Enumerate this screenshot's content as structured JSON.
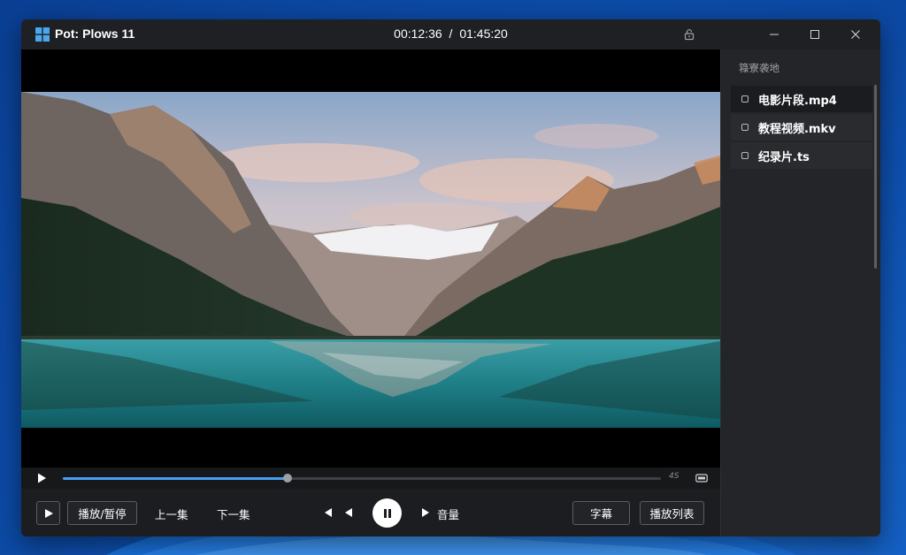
{
  "window": {
    "title": "Pot: Plows 11",
    "current_time": "00:12:36",
    "time_separator": "/",
    "total_time": "01:45:20"
  },
  "icons": {
    "app_logo": "windows-logo-icon",
    "lock": "lock-icon",
    "minimize": "minimize-icon",
    "maximize": "maximize-icon",
    "close": "close-icon",
    "play": "play-icon",
    "pause": "pause-icon",
    "previous": "previous-icon",
    "rewind": "rewind-icon",
    "forward": "forward-icon",
    "aspect": "aspect-ratio-icon"
  },
  "progress": {
    "fraction": 0.376,
    "side_label": "4S"
  },
  "controls": {
    "play_pause_label": "播放/暂停",
    "prev_label": "上一集",
    "next_label": "下一集",
    "volume_label": "音量",
    "subtitle_label": "字幕",
    "playlist_label": "播放列表"
  },
  "sidebar": {
    "title": "簶寮袭地",
    "items": [
      {
        "label": "电影片段.mp4",
        "active": true
      },
      {
        "label": "教程视频.mkv",
        "active": false
      },
      {
        "label": "纪录片.ts",
        "active": false
      }
    ]
  },
  "colors": {
    "accent": "#4a9ef0",
    "window_bg": "#1c1d20",
    "sidebar_bg": "#242529",
    "desktop": "#0d4fae"
  }
}
